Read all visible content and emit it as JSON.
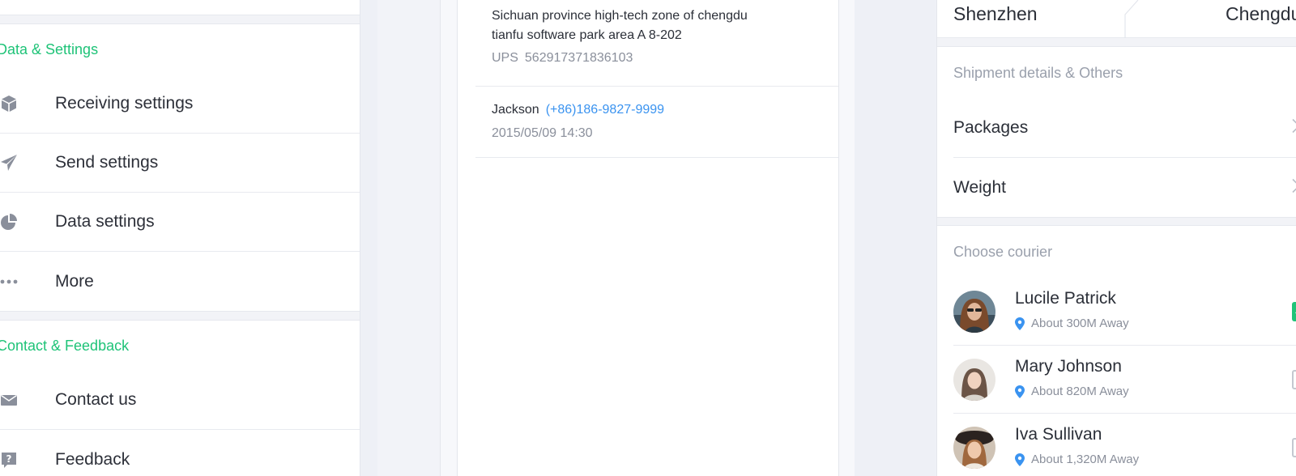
{
  "settings_panel": {
    "section_data": "Data & Settings",
    "items_data": [
      {
        "label": "Receiving settings",
        "icon": "box-icon"
      },
      {
        "label": "Send settings",
        "icon": "paper-plane-icon"
      },
      {
        "label": "Data settings",
        "icon": "pie-chart-icon"
      },
      {
        "label": "More",
        "icon": "more-dots-icon"
      }
    ],
    "section_contact": "Contact & Feedback",
    "items_contact": [
      {
        "label": "Contact us",
        "icon": "envelope-icon"
      },
      {
        "label": "Feedback",
        "icon": "help-icon"
      }
    ],
    "accent_color": "#1fc378",
    "icon_color": "#8a8f9b"
  },
  "address_panel": {
    "address_line1": "Sichuan province high-tech zone of chengdu",
    "address_line2": "tianfu software park area A 8-202",
    "carrier": "UPS",
    "tracking_number": "562917371836103",
    "contact_name": "Jackson",
    "contact_phone": "(+86)186-9827-9999",
    "datetime": "2015/05/09 14:30",
    "link_color": "#3a93f0"
  },
  "shipment_panel": {
    "from_city": "Shenzhen",
    "to_city": "Chengdu",
    "details_title": "Shipment details & Others",
    "packages_label": "Packages",
    "weight_label": "Weight",
    "courier_title": "Choose courier",
    "couriers": [
      {
        "name": "Lucile Patrick",
        "distance": "About 300M Away",
        "selected": true
      },
      {
        "name": "Mary Johnson",
        "distance": "About 820M Away",
        "selected": false
      },
      {
        "name": "Iva Sullivan",
        "distance": "About 1,320M Away",
        "selected": false
      }
    ],
    "check_color": "#1fc378",
    "pin_color": "#3a93f0"
  }
}
